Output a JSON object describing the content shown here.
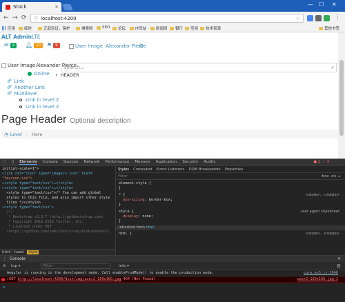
{
  "browser": {
    "tab_title": "Stock",
    "tab_close": "×",
    "url": "localhost:4200",
    "url_icon": "ⓘ",
    "star": "☆",
    "win_min": "—",
    "win_max": "☐",
    "win_close": "✕",
    "back": "←",
    "forward": "→",
    "reload": "⟳",
    "bookmarks": [
      "应用",
      "临时",
      "正起验证，保护",
      "搜索网",
      "SEO",
      "论坛",
      "IT同站",
      "新闻网",
      "银行",
      "空间",
      "技术资源"
    ],
    "other_bookmarks": "其他书签"
  },
  "app": {
    "logo_bold": "ALT Admin",
    "logo_rest": "LTE",
    "messages_count": "4",
    "notifications_count": "10",
    "tasks_count": "9",
    "user_image_alt": "User Image",
    "user_name": "Alexander Pierce",
    "sidebar_user_alt": "User Image",
    "sidebar_user_name": "Alexander Pierce",
    "online_label": "Online",
    "search_placeholder": "Search...",
    "header_label": "HEADER",
    "menu": [
      {
        "label": "Link"
      },
      {
        "label": "Another Link"
      },
      {
        "label": "Multilevel"
      }
    ],
    "submenu": [
      {
        "label": "Link in level 2"
      },
      {
        "label": "Link in level 2"
      }
    ],
    "page_header_title": "Page Header",
    "page_header_desc": "Optional description",
    "breadcrumb_level": "Level",
    "breadcrumb_sep": "/",
    "breadcrumb_here": "Here"
  },
  "devtools": {
    "tabs": [
      "Elements",
      "Console",
      "Sources",
      "Network",
      "Performance",
      "Memory",
      "Application",
      "Security",
      "Audits"
    ],
    "active_tab": "Elements",
    "error_count": "1",
    "elements_lines": [
      "initial-scale=1\">",
      "<link rel=\"icon\" type=\"image/x-icon\" href=",
      "\"favicon.ico\">",
      "▸<style type=\"text/css\">…</style>",
      "▸<style type=\"text/css\">…</style>",
      "  <style type=\"text/css\">/* You can add global",
      "  styles to this file, and also import other style",
      "  files */</style>",
      "▾<style type=\"text/css\">",
      "  /*!",
      "   * Bootstrap v3.3.7 (http://getbootstrap.com)",
      "   * Copyright 2011-2016 Twitter, Inc.",
      "   * Licensed under MIT",
      "  (https://github.com/twbs/bootstrap/blob/master/L"
    ],
    "el_crumbs": [
      "html",
      "head",
      "style"
    ],
    "styles_tabs": [
      "Styles",
      "Computed",
      "Event Listeners",
      "DOM Breakpoints",
      "Properties"
    ],
    "filter_placeholder": "Filter",
    "hov_cls": ":hov  .cls  +",
    "rule1_selector": "element.style {",
    "rule1_close": "}",
    "rule2_selector": "* {",
    "rule2_prop": "box-sizing",
    "rule2_val": "border-box;",
    "rule2_close": "}",
    "rule2_src": "<style>…</style>",
    "rule3_selector": "style {",
    "rule3_prop": "display",
    "rule3_val": "none;",
    "rule3_close": "}",
    "rule3_src": "user agent stylesheet",
    "inherited_label": "Inherited from",
    "inherited_tag": "html",
    "rule4_selector": "html {",
    "rule4_src": "<style>…</style>",
    "console_title": "Console",
    "console_close": "✕",
    "console_context": "top",
    "console_filter": "Filter",
    "console_level": "Info",
    "console_msg1": "Angular is running in the development mode. Call enableProdMode() to enable the production mode.",
    "console_msg1_src": "core.es5.js:3046",
    "console_msg2_prefix": "▸GET ",
    "console_msg2_url": "http://localhost:4200/dist/img/user2-160x160.jpg",
    "console_msg2_status": " 404 (Not Found)",
    "console_msg2_src": "user2-160x160.jpg:1",
    "prompt": ">"
  }
}
